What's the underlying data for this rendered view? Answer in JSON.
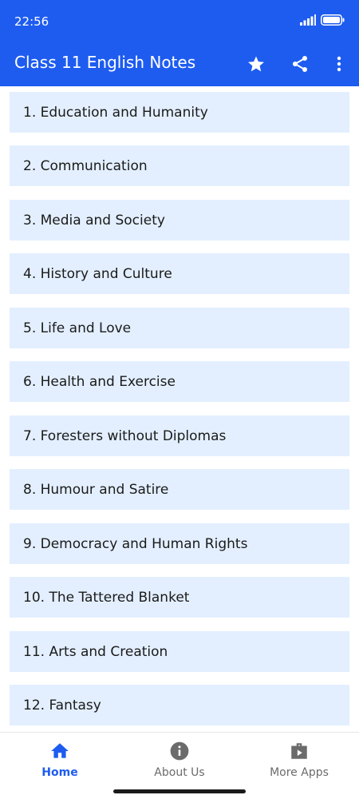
{
  "status_bar": {
    "time": "22:56",
    "icons": [
      "signal-icon",
      "battery-icon"
    ]
  },
  "app_bar": {
    "title": "Class 11 English Notes",
    "actions": [
      "star-icon",
      "share-icon",
      "more-vert-icon"
    ]
  },
  "chapters": [
    "1. Education and Humanity",
    "2. Communication",
    "3. Media and Society",
    "4. History and Culture",
    "5. Life and Love",
    "6. Health and Exercise",
    "7. Foresters without Diplomas",
    "8. Humour and Satire",
    "9. Democracy and Human Rights",
    "10. The Tattered Blanket",
    "11. Arts and Creation",
    "12. Fantasy"
  ],
  "bottom_nav": {
    "home": "Home",
    "about": "About Us",
    "more_apps": "More Apps",
    "active": "Home"
  },
  "colors": {
    "primary": "#1e5cf0",
    "list_item_bg": "#e3efff",
    "nav_inactive": "#6b6b6b"
  }
}
